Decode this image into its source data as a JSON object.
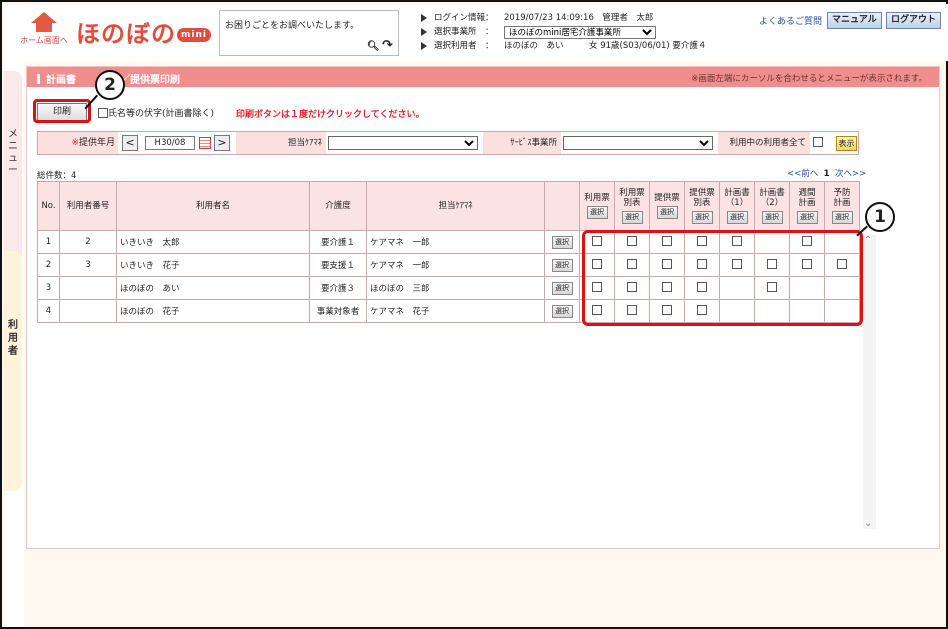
{
  "header": {
    "home_label": "ホーム画面へ",
    "logo_text": "ほのぼの",
    "logo_badge": "mini",
    "help_text": "お困りごとをお調べいたします。",
    "login_key": "ログイン情報：",
    "login_value": "2019/07/23 14:09:16　管理者　太郎",
    "office_key": "選択事業所　：",
    "office_value": "ほのぼのmini居宅介護事業所",
    "user_key": "選択利用者　：",
    "user_value": "ほのぼの　あい　　　女 91歳(S03/06/01) 要介護４",
    "faq": "よくあるご質問",
    "manual": "マニュアル",
    "logout": "ログアウト"
  },
  "side": {
    "menu_tab": "メニュー",
    "user_tab": "利用者"
  },
  "page": {
    "title_a": "計画書",
    "title_b": "票／提供票印刷",
    "hint": "※画面左端にカーソルを合わせるとメニューが表示されます。",
    "print_label": "印刷",
    "anon_label": "氏名等の伏字(計画書除く)",
    "warning": "印刷ボタンは１度だけクリックしてください。"
  },
  "filter": {
    "month_label": "提供年月",
    "month_value": "H30/08",
    "prev": "<",
    "next": ">",
    "cm_label": "担当ｹｱﾏﾈ",
    "service_label": "ｻｰﾋﾞｽ事業所",
    "inuse_label": "利用中の利用者全て",
    "show_label": "表示"
  },
  "list": {
    "total": "総件数：4",
    "pager_prev": "<<前へ",
    "pager_page": "1",
    "pager_next": "次へ>>",
    "select_label": "選択",
    "headers": {
      "no": "No.",
      "user_no": "利用者番号",
      "user_name": "利用者名",
      "care_level": "介護度",
      "care_manager": "担当ｹｱﾏﾈ",
      "col1": "利用票",
      "col2": "利用票別表",
      "col3": "提供票",
      "col4": "提供票別表",
      "col5": "計画書（1）",
      "col6": "計画書（2）",
      "col7": "週間計画",
      "col8": "予防計画"
    },
    "rows": [
      {
        "no": "1",
        "user_no": "2",
        "name": "いきいき　太郎",
        "level": "要介護１",
        "cm": "ケアマネ　一郎",
        "checks": [
          true,
          true,
          true,
          true,
          true,
          false,
          true,
          false
        ]
      },
      {
        "no": "2",
        "user_no": "3",
        "name": "いきいき　花子",
        "level": "要支援１",
        "cm": "ケアマネ　一郎",
        "checks": [
          true,
          true,
          true,
          true,
          true,
          true,
          true,
          true
        ]
      },
      {
        "no": "3",
        "user_no": "",
        "name": "ほのぼの　あい",
        "level": "要介護３",
        "cm": "ほのぼの　三郎",
        "checks": [
          true,
          true,
          true,
          true,
          false,
          true,
          false,
          false
        ]
      },
      {
        "no": "4",
        "user_no": "",
        "name": "ほのぼの　花子",
        "level": "事業対象者",
        "cm": "ケアマネ　花子",
        "checks": [
          true,
          true,
          true,
          true,
          false,
          false,
          false,
          false
        ]
      }
    ]
  },
  "callouts": {
    "one": "1",
    "two": "2"
  },
  "colors": {
    "accent": "#f08d8d",
    "header_cell": "#fbe3e3",
    "warning": "#e0222a",
    "callout_box": "#dd1111"
  }
}
